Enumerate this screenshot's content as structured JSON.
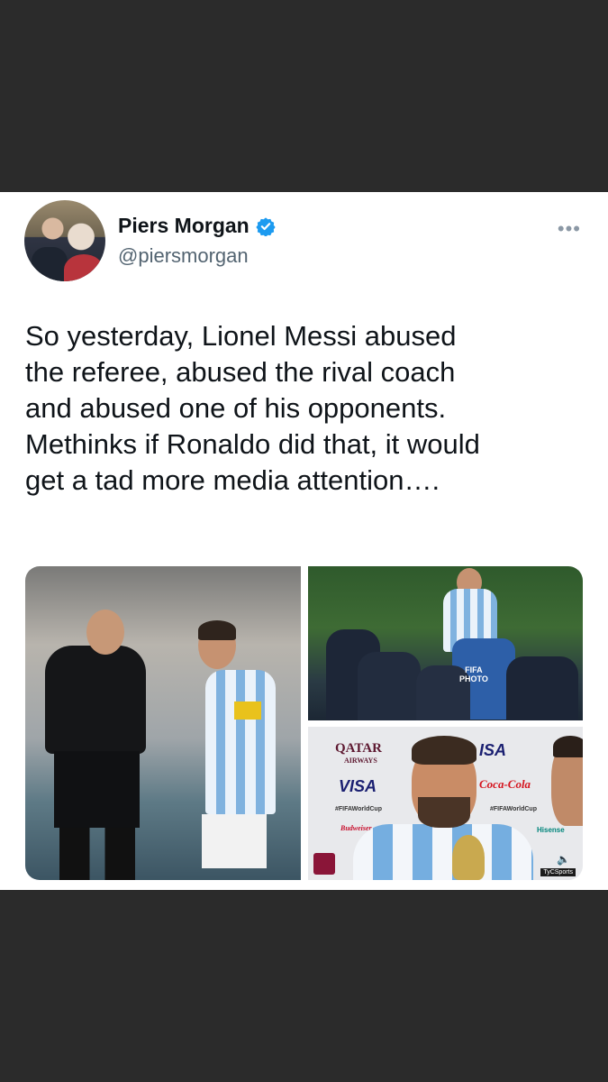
{
  "tweet": {
    "author_name": "Piers Morgan",
    "handle": "@piersmorgan",
    "text": "So yesterday, Lionel Messi abused\nthe referee, abused the rival coach\nand abused one of his opponents.\nMethinks if Ronaldo did that, it would\nget a tad more media attention….",
    "more_label": "•••"
  },
  "media": {
    "photo2_watermark": "FIFA\nPHOTO",
    "photo3_sponsors": {
      "qatar": "QATAR",
      "airways": "AIRWAYS",
      "visa": "VISA",
      "visa_partial": "ISA",
      "tag": "#FIFAWorldCup",
      "budweiser": "Budweiser",
      "cocacola": "Coca-Cola",
      "hisense": "Hisense"
    },
    "tv_bug": "TyCSports"
  },
  "colors": {
    "verified_blue": "#1d9bf0",
    "background": "#2b2b2b",
    "card": "#ffffff"
  }
}
